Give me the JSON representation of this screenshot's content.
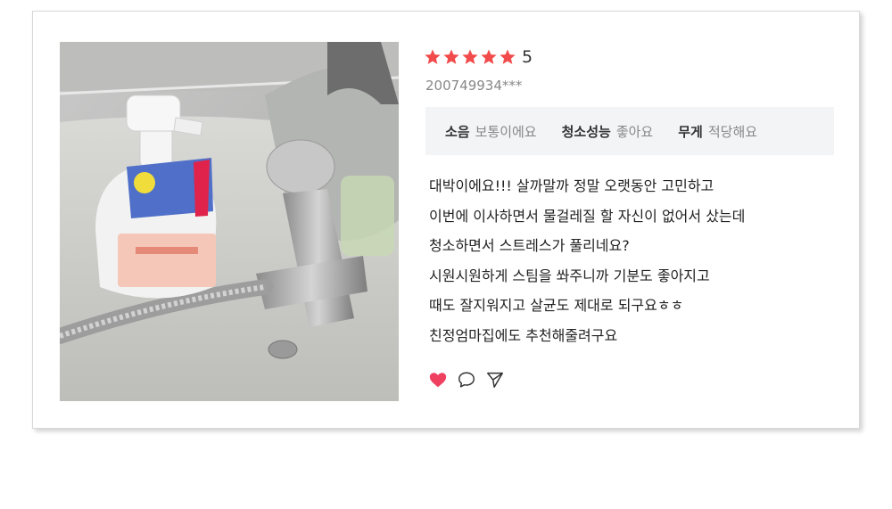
{
  "review": {
    "score": "5",
    "star_count": 5,
    "star_color": "#f24b4b",
    "user_id": "200749934***",
    "attributes": [
      {
        "key": "소음",
        "value": "보통이에요"
      },
      {
        "key": "청소성능",
        "value": "좋아요"
      },
      {
        "key": "무게",
        "value": "적당해요"
      }
    ],
    "lines": [
      "대박이에요!!! 살까말까 정말 오랫동안 고민하고",
      "이번에 이사하면서 물걸레질 할 자신이 없어서 샀는데",
      "청소하면서 스트레스가 풀리네요?",
      "시원시원하게 스팀을 쏴주니까 기분도 좋아지고",
      "때도 잘지워지고 살균도 제대로 되구요ㅎㅎ",
      "친정엄마집에도 추천해줄려구요"
    ],
    "actions": {
      "like_icon": "heart-icon",
      "comment_icon": "speech-bubble-icon",
      "share_icon": "paper-plane-icon",
      "like_color": "#ef4060"
    }
  }
}
